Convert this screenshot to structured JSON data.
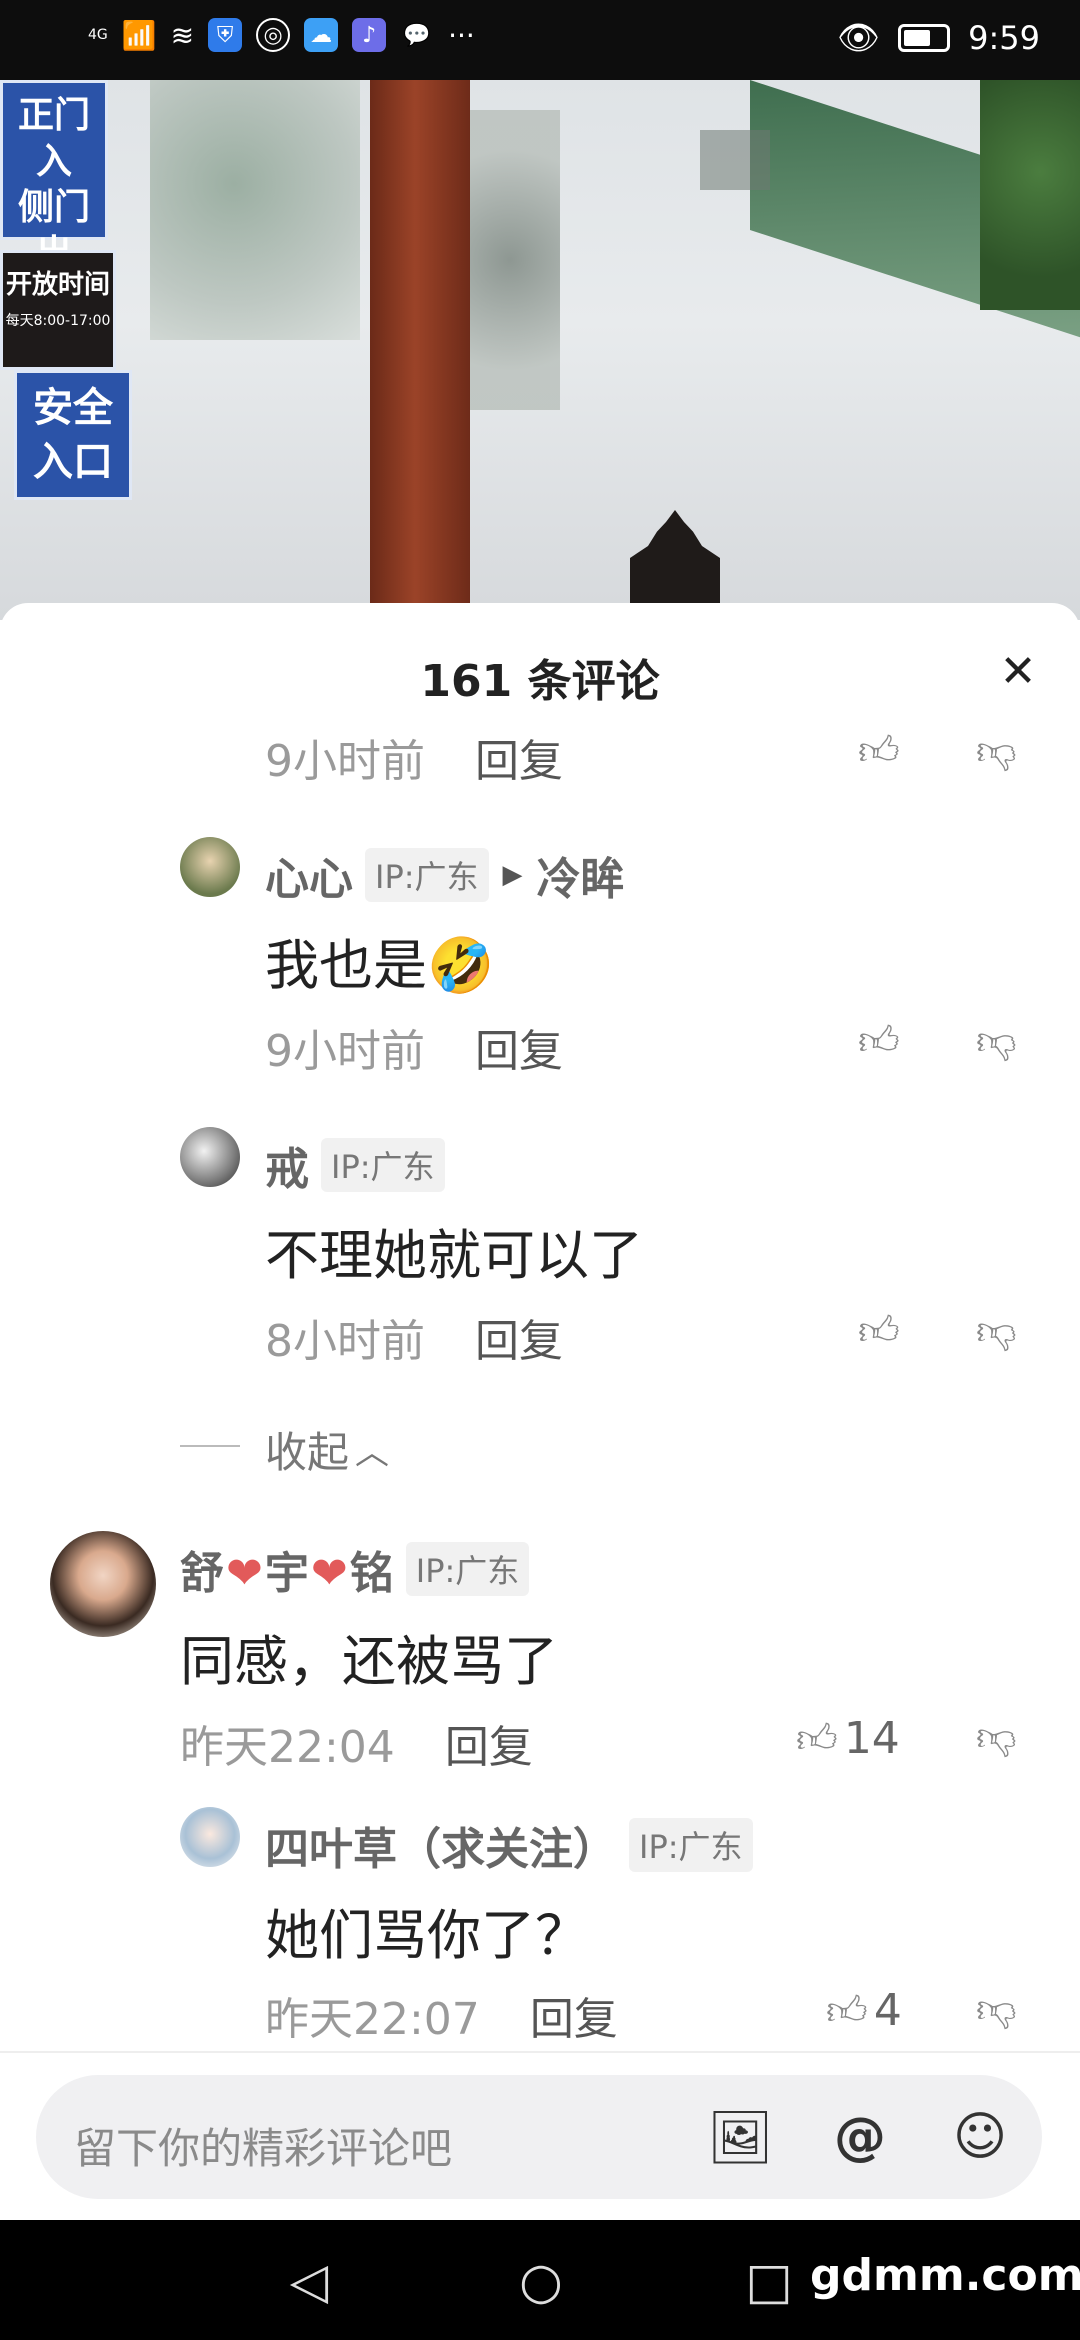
{
  "status_bar": {
    "network": "4G",
    "time": "9:59"
  },
  "video": {
    "sign_a": [
      "正门入",
      "侧门出"
    ],
    "sign_b": {
      "title": [
        "开放时间"
      ],
      "hours": "每天8:00-17:00"
    },
    "sign_c": [
      "安全",
      "入口"
    ]
  },
  "comments_panel": {
    "title": "161 条评论",
    "close_icon": "close-icon"
  },
  "comments": [
    {
      "time": "9小时前",
      "reply": "回复"
    },
    {
      "user": "心心",
      "ip": "IP:广东",
      "reply_to": "冷眸",
      "text": "我也是",
      "emoji": "🤣",
      "time": "9小时前",
      "reply": "回复"
    },
    {
      "user": "戒",
      "ip": "IP:广东",
      "text": "不理她就可以了",
      "time": "8小时前",
      "reply": "回复"
    }
  ],
  "collapse_label": "收起",
  "main_comment": {
    "user_parts": [
      "舒",
      "宇",
      "铭"
    ],
    "ip": "IP:广东",
    "text": "同感，还被骂了",
    "time": "昨天22:04",
    "reply": "回复",
    "likes": "14"
  },
  "sub_comment": {
    "user": "四叶草（求关注）",
    "ip": "IP:广东",
    "text": "她们骂你了？",
    "time": "昨天22:07",
    "reply": "回复",
    "likes": "4"
  },
  "input": {
    "placeholder": "留下你的精彩评论吧"
  },
  "watermark": "gdmm.com"
}
